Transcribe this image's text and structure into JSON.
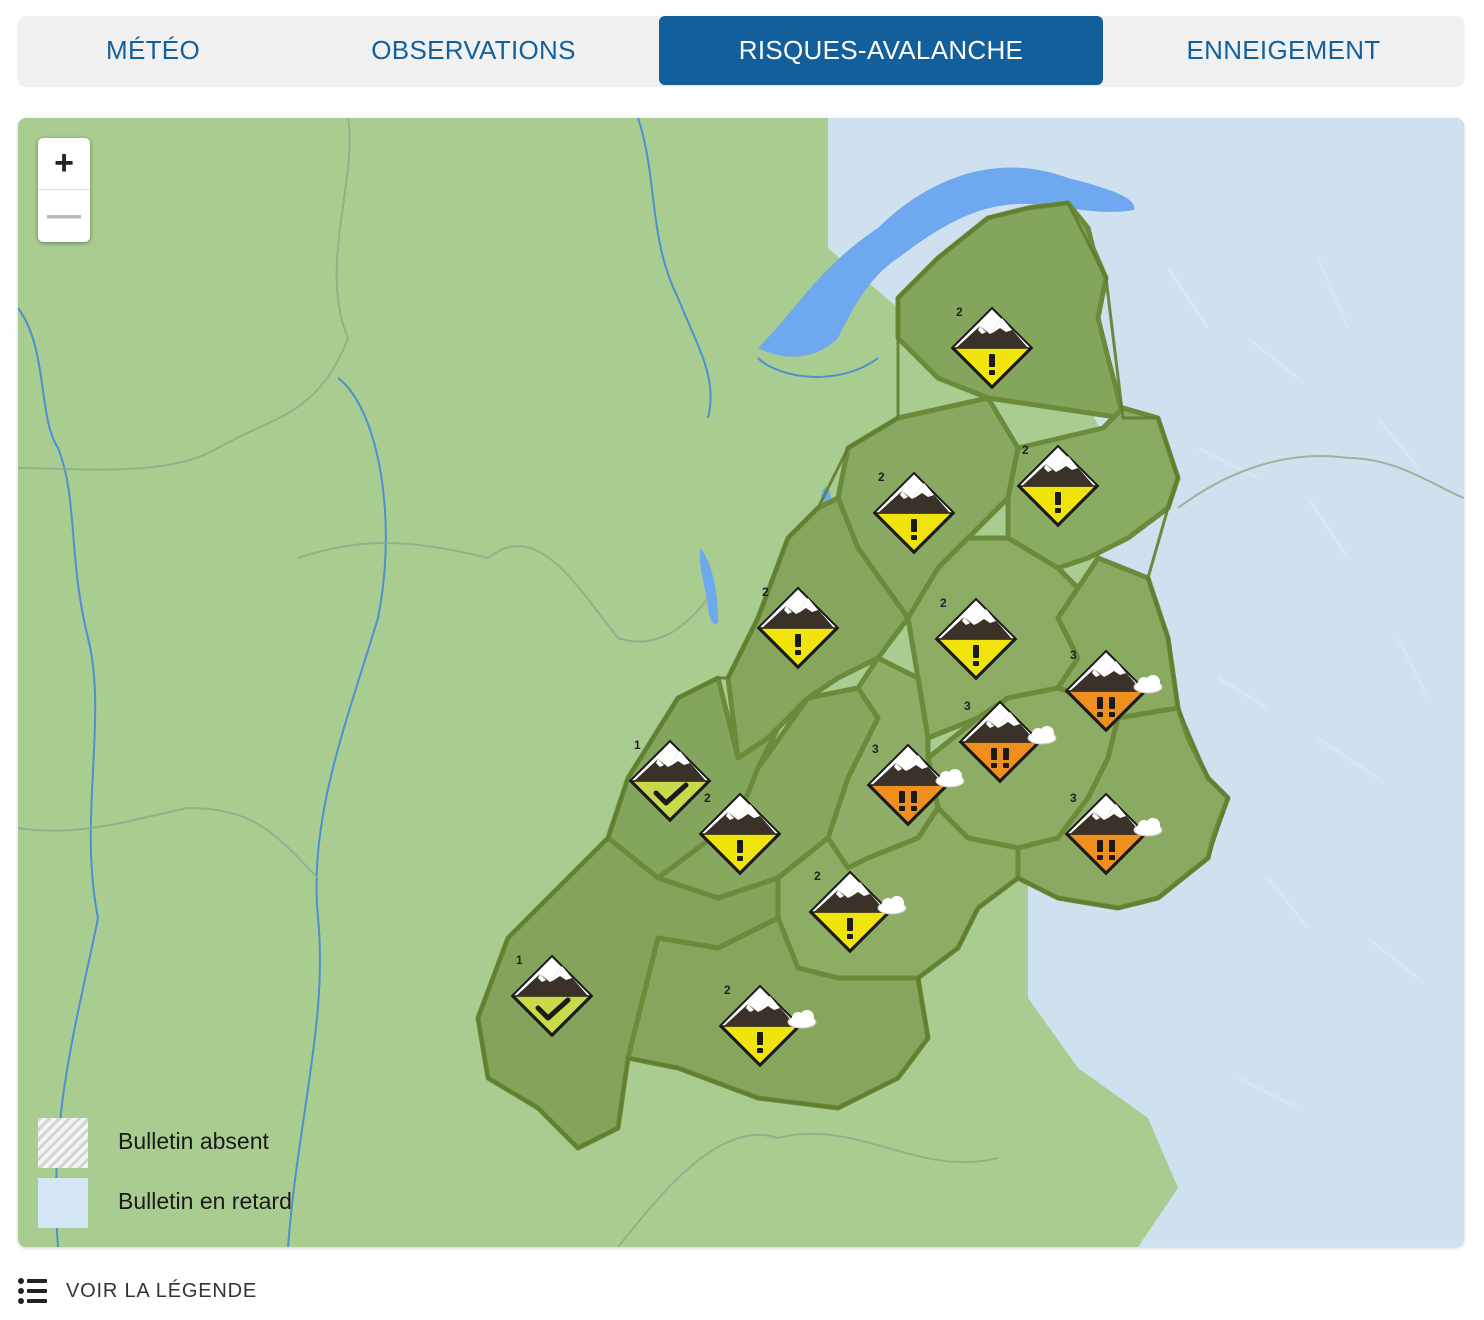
{
  "tabs": [
    {
      "label": "MÉTÉO",
      "active": false
    },
    {
      "label": "OBSERVATIONS",
      "active": false
    },
    {
      "label": "RISQUES-AVALANCHE",
      "active": true
    },
    {
      "label": "ENNEIGEMENT",
      "active": false
    }
  ],
  "zoom": {
    "in_label": "+",
    "out_label": "—"
  },
  "legend": {
    "absent_label": "Bulletin absent",
    "late_label": "Bulletin en retard"
  },
  "voir_legende": "VOIR LA LÉGENDE",
  "colors": {
    "accent": "#125f9c",
    "risk_1": "#c9d94a",
    "risk_2": "#f1e40c",
    "risk_3": "#ee8f1e",
    "massif_fill": "#7fa35a",
    "lake": "#6ea9ef",
    "lowland": "#a9cd91",
    "mountain_bg": "#cfe1ee"
  },
  "massifs": [
    {
      "risk": "2",
      "risk_icon": "exclamation-icon",
      "weather": "clear"
    },
    {
      "risk": "2",
      "risk_icon": "exclamation-icon",
      "weather": "clear"
    },
    {
      "risk": "2",
      "risk_icon": "exclamation-icon",
      "weather": "clear"
    },
    {
      "risk": "2",
      "risk_icon": "exclamation-icon",
      "weather": "clear"
    },
    {
      "risk": "2",
      "risk_icon": "exclamation-icon",
      "weather": "clear"
    },
    {
      "risk": "3",
      "risk_icon": "double-exclamation-icon",
      "weather": "cloud"
    },
    {
      "risk": "3",
      "risk_icon": "double-exclamation-icon",
      "weather": "cloud"
    },
    {
      "risk": "1",
      "risk_icon": "checkmark-icon",
      "weather": "clear"
    },
    {
      "risk": "2",
      "risk_icon": "exclamation-icon",
      "weather": "clear"
    },
    {
      "risk": "3",
      "risk_icon": "double-exclamation-icon",
      "weather": "cloud"
    },
    {
      "risk": "3",
      "risk_icon": "double-exclamation-icon",
      "weather": "cloud"
    },
    {
      "risk": "2",
      "risk_icon": "exclamation-icon",
      "weather": "cloud"
    },
    {
      "risk": "1",
      "risk_icon": "checkmark-icon",
      "weather": "clear"
    },
    {
      "risk": "2",
      "risk_icon": "exclamation-icon",
      "weather": "cloud"
    }
  ]
}
